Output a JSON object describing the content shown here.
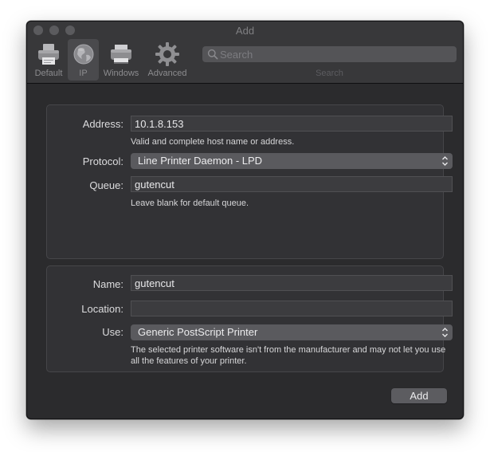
{
  "window": {
    "title": "Add"
  },
  "toolbar": {
    "items": [
      {
        "label": "Default",
        "icon": "printer-icon"
      },
      {
        "label": "IP",
        "icon": "globe-icon"
      },
      {
        "label": "Windows",
        "icon": "windows-printer-icon"
      },
      {
        "label": "Advanced",
        "icon": "gear-icon"
      }
    ],
    "selected": "IP",
    "search": {
      "placeholder": "Search",
      "value": "",
      "caption": "Search"
    }
  },
  "connection": {
    "address_label": "Address:",
    "address_value": "10.1.8.153",
    "address_hint": "Valid and complete host name or address.",
    "protocol_label": "Protocol:",
    "protocol_value": "Line Printer Daemon - LPD",
    "queue_label": "Queue:",
    "queue_value": "gutencut",
    "queue_hint": "Leave blank for default queue."
  },
  "printer": {
    "name_label": "Name:",
    "name_value": "gutencut",
    "location_label": "Location:",
    "location_value": "",
    "use_label": "Use:",
    "use_value": "Generic PostScript Printer",
    "use_hint": "The selected printer software isn't from the manufacturer and may not let you use all the features of your printer."
  },
  "actions": {
    "add_label": "Add"
  },
  "colors": {
    "window_bg": "#2b2b2d",
    "toolbar_bg": "#38383a",
    "panel_bg": "#323235",
    "popup_bg": "#5a5a5e"
  }
}
